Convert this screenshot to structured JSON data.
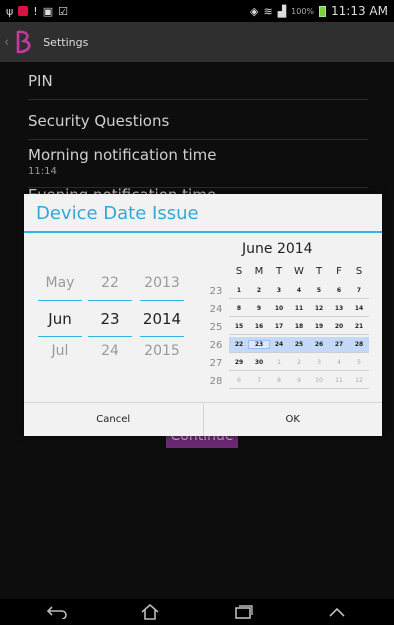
{
  "statusbar": {
    "left_icons": [
      "usb-icon",
      "notification-icon",
      "alert-icon",
      "photo-icon",
      "calendar-check-icon"
    ],
    "signal_text": "100%",
    "time": "11:13 AM"
  },
  "actionbar": {
    "title": "Settings"
  },
  "settings": {
    "pin_label": "PIN",
    "security_label": "Security Questions",
    "morning_label": "Morning notification time",
    "morning_value": "11:14",
    "evening_label": "Evening notification time",
    "continue_label": "Continue"
  },
  "dialog": {
    "title": "Device Date Issue",
    "picker": {
      "month": {
        "prev": "May",
        "current": "Jun",
        "next": "Jul"
      },
      "day": {
        "prev": "22",
        "current": "23",
        "next": "24"
      },
      "year": {
        "prev": "2013",
        "current": "2014",
        "next": "2015"
      }
    },
    "calendar": {
      "title": "June 2014",
      "weekdays": [
        "S",
        "M",
        "T",
        "W",
        "T",
        "F",
        "S"
      ],
      "weeks": [
        {
          "num": "23",
          "days": [
            "1",
            "2",
            "3",
            "4",
            "5",
            "6",
            "7"
          ]
        },
        {
          "num": "24",
          "days": [
            "8",
            "9",
            "10",
            "11",
            "12",
            "13",
            "14"
          ]
        },
        {
          "num": "25",
          "days": [
            "15",
            "16",
            "17",
            "18",
            "19",
            "20",
            "21"
          ]
        },
        {
          "num": "26",
          "days": [
            "22",
            "23",
            "24",
            "25",
            "26",
            "27",
            "28"
          ]
        },
        {
          "num": "27",
          "days": [
            "29",
            "30",
            "1",
            "2",
            "3",
            "4",
            "5"
          ]
        },
        {
          "num": "28",
          "days": [
            "6",
            "7",
            "8",
            "9",
            "10",
            "11",
            "12"
          ]
        }
      ],
      "selected_day": "23"
    },
    "cancel_label": "Cancel",
    "ok_label": "OK"
  },
  "navbar": {
    "icons": [
      "back-icon",
      "home-icon",
      "recents-icon",
      "menu-up-icon"
    ]
  },
  "colors": {
    "accent": "#33b5e5",
    "title": "#33a8d6",
    "week_highlight": "#c3d9f7",
    "button_purple": "#6a2a72"
  }
}
